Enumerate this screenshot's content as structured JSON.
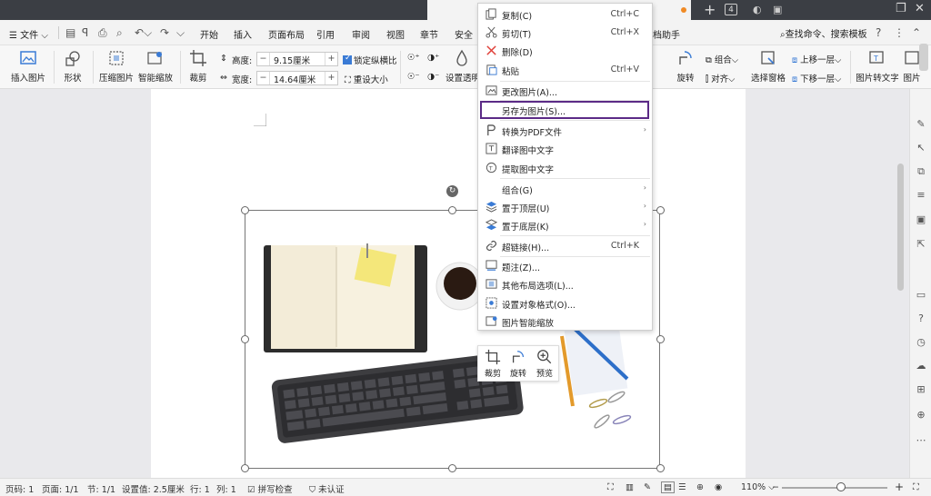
{
  "titlebar": {
    "tab_count": "4"
  },
  "menubar": {
    "file_label": "文件",
    "tabs": [
      "开始",
      "插入",
      "页面布局",
      "引用",
      "审阅",
      "视图",
      "章节",
      "安全"
    ],
    "assistant_label": "档助手",
    "search_label": "查找命令、搜索模板"
  },
  "ribbon": {
    "insert_picture": "插入图片",
    "shape": "形状",
    "compress_picture": "压缩图片",
    "smart_zoom": "智能缩放",
    "crop": "裁剪",
    "height_label": "高度:",
    "height_value": "9.15厘米",
    "width_label": "宽度:",
    "width_value": "14.64厘米",
    "lock_ratio": "锁定纵横比",
    "reset_size": "重设大小",
    "set_transparent": "设置透明",
    "rotate": "旋转",
    "group": "组合",
    "align": "对齐",
    "selection_pane": "选择窗格",
    "bring_forward": "上移一层",
    "send_backward": "下移一层",
    "picture_to_text": "图片转文字",
    "picture_more": "图片"
  },
  "context_menu": {
    "items": [
      {
        "label": "复制(C)",
        "shortcut": "Ctrl+C"
      },
      {
        "label": "剪切(T)",
        "shortcut": "Ctrl+X"
      },
      {
        "label": "删除(D)",
        "shortcut": ""
      },
      {
        "label": "粘贴",
        "shortcut": "Ctrl+V"
      },
      {
        "label": "更改图片(A)...",
        "shortcut": ""
      },
      {
        "label": "另存为图片(S)...",
        "shortcut": ""
      },
      {
        "label": "转换为PDF文件",
        "shortcut": ""
      },
      {
        "label": "翻译图中文字",
        "shortcut": ""
      },
      {
        "label": "提取图中文字",
        "shortcut": ""
      },
      {
        "label": "组合(G)",
        "shortcut": ""
      },
      {
        "label": "置于顶层(U)",
        "shortcut": ""
      },
      {
        "label": "置于底层(K)",
        "shortcut": ""
      },
      {
        "label": "超链接(H)...",
        "shortcut": "Ctrl+K"
      },
      {
        "label": "题注(Z)...",
        "shortcut": ""
      },
      {
        "label": "其他布局选项(L)...",
        "shortcut": ""
      },
      {
        "label": "设置对象格式(O)...",
        "shortcut": ""
      },
      {
        "label": "图片智能缩放",
        "shortcut": ""
      }
    ]
  },
  "mini_toolbar": {
    "crop": "裁剪",
    "rotate": "旋转",
    "preview": "预览"
  },
  "statusbar": {
    "page_no": "页码: 1",
    "pages": "页面: 1/1",
    "section": "节: 1/1",
    "setting": "设置值: 2.5厘米",
    "row": "行: 1",
    "col": "列: 1",
    "spell_check": "拼写检查",
    "auth": "未认证",
    "zoom": "110%"
  },
  "colors": {
    "accent": "#3a7bd5",
    "highlight_border": "#5b2a86",
    "titlebar": "#3b3e44"
  }
}
